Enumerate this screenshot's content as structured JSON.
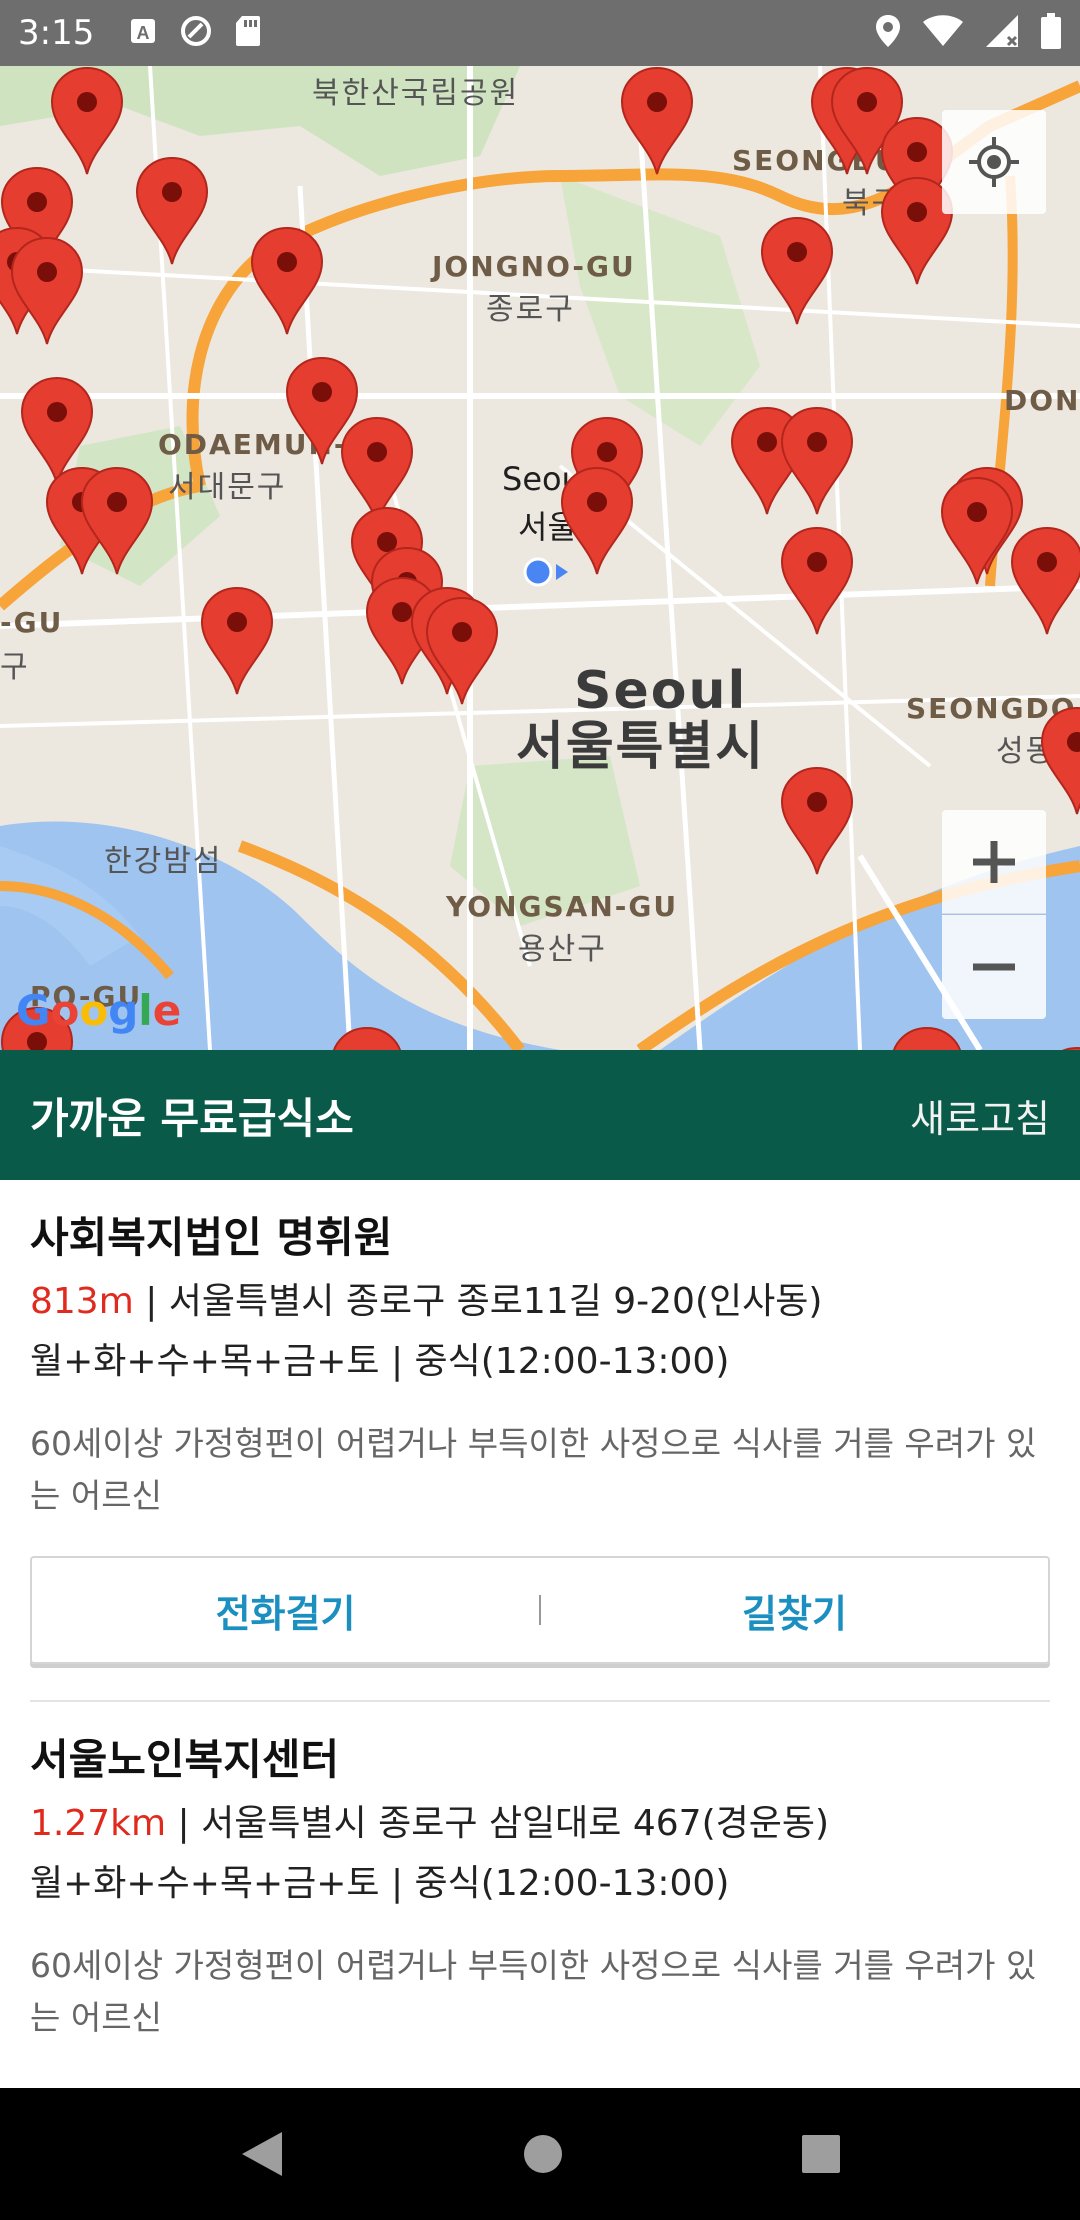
{
  "status_bar": {
    "time": "3:15",
    "icons_left": [
      "keyboard-a-icon",
      "sync-icon",
      "sd-card-icon"
    ],
    "icons_right": [
      "location-icon",
      "wifi-icon",
      "signal-icon",
      "battery-icon"
    ]
  },
  "map": {
    "labels": {
      "bukhansan": "북한산국립공원",
      "jongno_en": "JONGNO-GU",
      "jongno_ko": "종로구",
      "seodaemun_en": "ODAEMUN-GU",
      "seodaemun_ko": "서대문구",
      "seongbuk_en": "SEONGBU",
      "seongbuk_ko": "북구",
      "seoul_small_en": "Seou",
      "seoul_small_ko": "서울",
      "seoul_big_en": "Seoul",
      "seoul_big_ko": "서울특별시",
      "gu_left": "-GU",
      "gu_left_ko": "구",
      "seongdong_en": "SEONGDO",
      "seongdong_ko": "성동구",
      "don": "DON",
      "hangang": "한강밤섬",
      "yongsan_en": "YONGSAN-GU",
      "yongsan_ko": "용산구",
      "mapo": "PO-GU"
    },
    "google_logo": "Google",
    "zoom_in_label": "+",
    "zoom_out_label": "−"
  },
  "header": {
    "title": "가까운 무료급식소",
    "refresh": "새로고침"
  },
  "places": [
    {
      "name": "사회복지법인 명휘원",
      "distance": "813m",
      "address": " | 서울특별시 종로구 종로11길 9-20(인사동)",
      "schedule": "월+화+수+목+금+토 | 중식(12:00-13:00)",
      "description": "60세이상 가정형편이 어렵거나 부득이한 사정으로 식사를 거를 우려가 있는 어르신",
      "call_label": "전화걸기",
      "directions_label": "길찾기"
    },
    {
      "name": "서울노인복지센터",
      "distance": "1.27km",
      "address": " | 서울특별시 종로구 삼일대로 467(경운동)",
      "schedule": "월+화+수+목+금+토 | 중식(12:00-13:00)",
      "description": "60세이상 가정형편이 어렵거나 부득이한 사정으로 식사를 거를 우려가 있는 어르신"
    }
  ],
  "colors": {
    "header_bg": "#0a5a49",
    "distance": "#e02a1e",
    "action": "#1a8fc0",
    "marker": "#e53d30"
  }
}
